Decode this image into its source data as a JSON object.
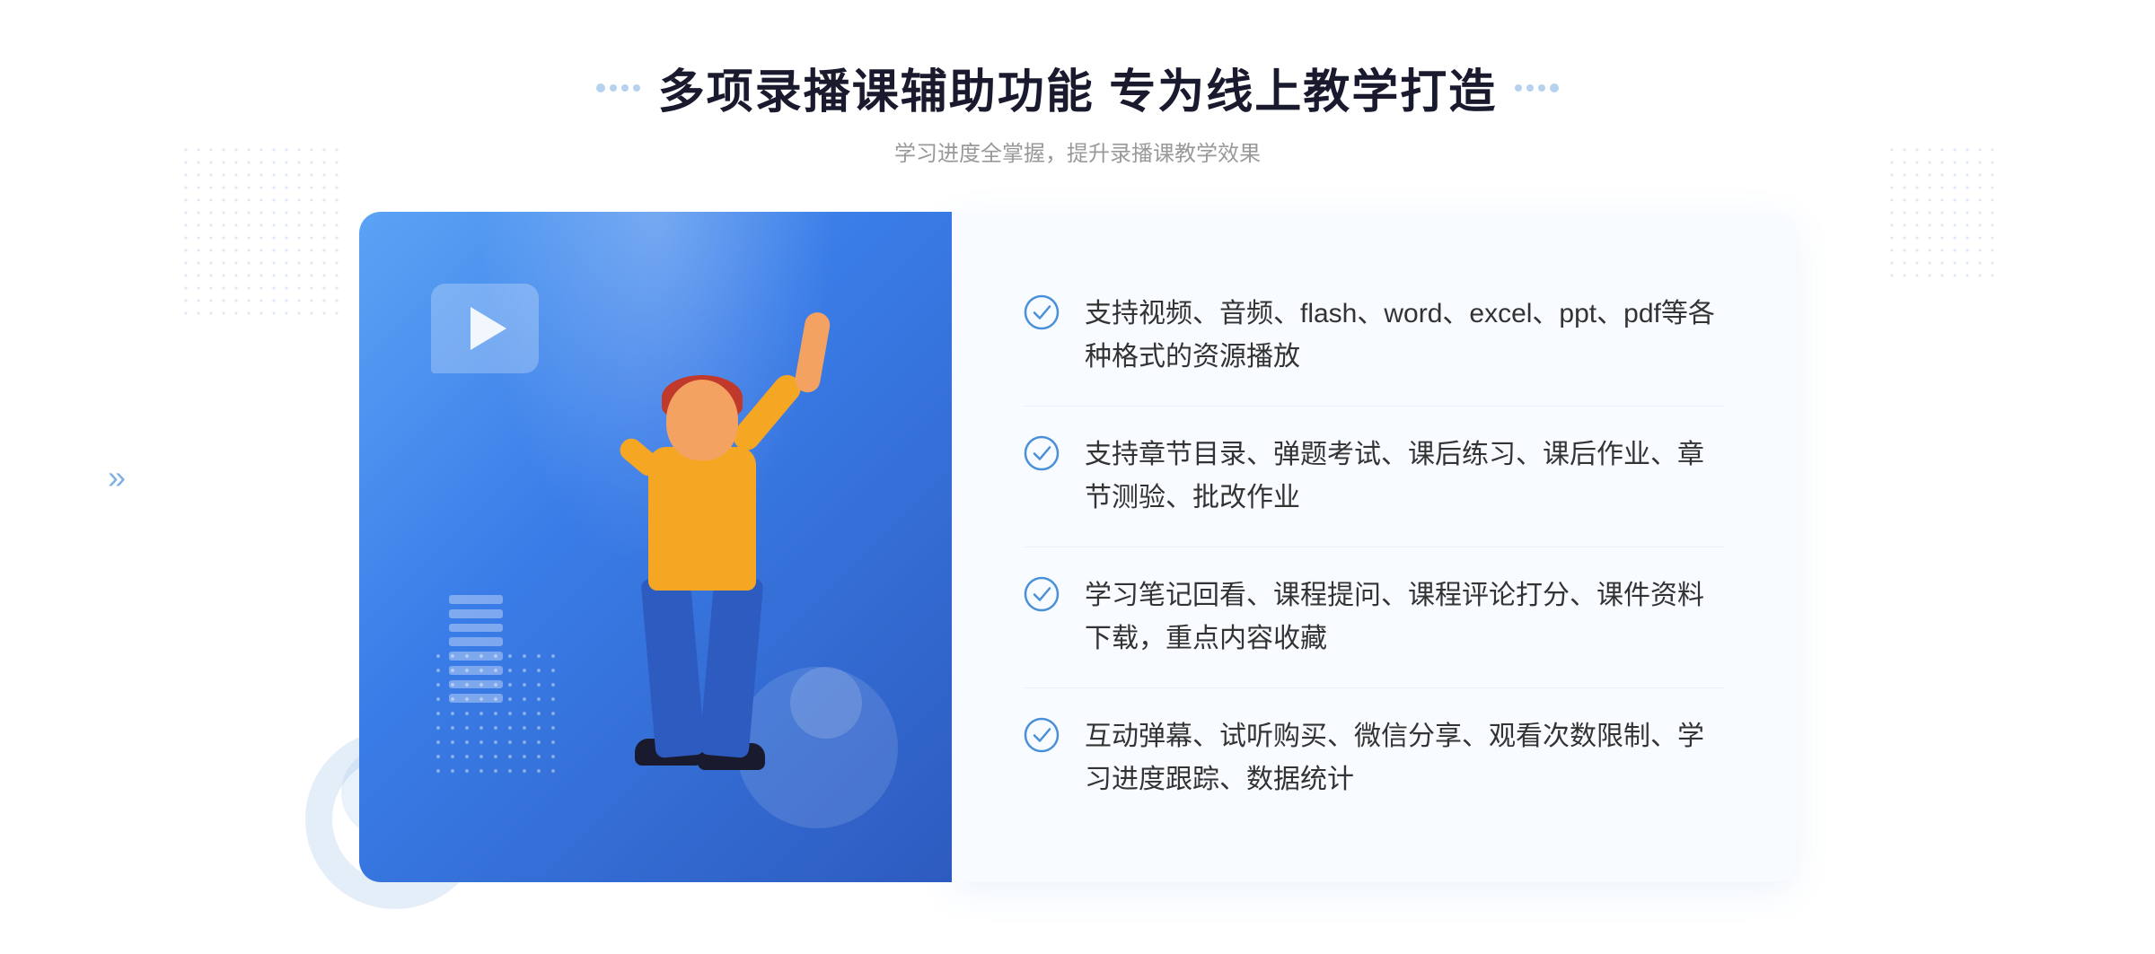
{
  "header": {
    "title": "多项录播课辅助功能 专为线上教学打造",
    "subtitle": "学习进度全掌握，提升录播课教学效果"
  },
  "features": [
    {
      "id": 1,
      "text": "支持视频、音频、flash、word、excel、ppt、pdf等各种格式的资源播放"
    },
    {
      "id": 2,
      "text": "支持章节目录、弹题考试、课后练习、课后作业、章节测验、批改作业"
    },
    {
      "id": 3,
      "text": "学习笔记回看、课程提问、课程评论打分、课件资料下载，重点内容收藏"
    },
    {
      "id": 4,
      "text": "互动弹幕、试听购买、微信分享、观看次数限制、学习进度跟踪、数据统计"
    }
  ],
  "icons": {
    "check": "check-circle-icon",
    "arrow": "chevron-right-icon",
    "dots_left": "decorative-dots-left",
    "dots_right": "decorative-dots-right"
  },
  "colors": {
    "primary": "#4a90d9",
    "primary_dark": "#2d5bbf",
    "text_main": "#1a1a2e",
    "text_secondary": "#999999",
    "text_feature": "#333333",
    "bg_panel": "#f8fbff",
    "gradient_start": "#5ba3f5",
    "gradient_end": "#2d5bbf"
  }
}
